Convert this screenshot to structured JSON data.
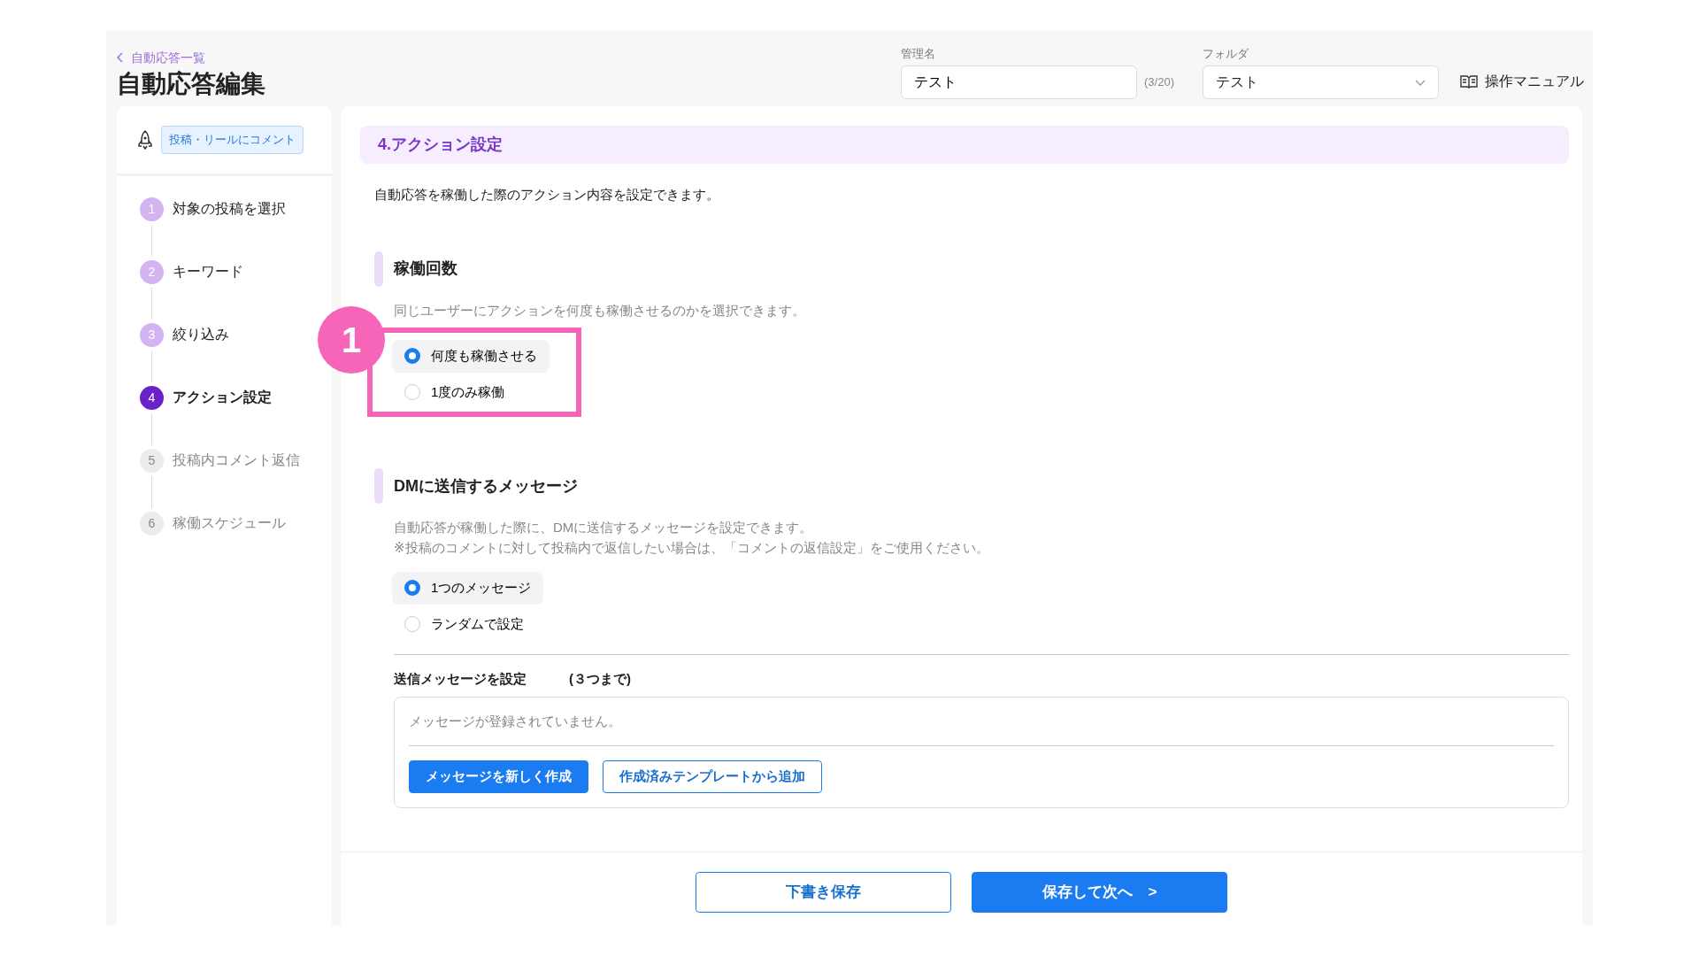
{
  "header": {
    "back_link": "自動応答一覧",
    "title": "自動応答編集",
    "name_field": {
      "label": "管理名",
      "value": "テスト",
      "counter": "(3/20)"
    },
    "folder_field": {
      "label": "フォルダ",
      "value": "テスト"
    },
    "manual_link": "操作マニュアル"
  },
  "sidebar": {
    "trigger_badge": "投稿・リールにコメント",
    "steps": [
      {
        "number": "1",
        "label": "対象の投稿を選択",
        "completed": true,
        "selected": false
      },
      {
        "number": "2",
        "label": "キーワード",
        "completed": true,
        "selected": false
      },
      {
        "number": "3",
        "label": "絞り込み",
        "completed": true,
        "selected": false
      },
      {
        "number": "4",
        "label": "アクション設定",
        "completed": false,
        "selected": true
      },
      {
        "number": "5",
        "label": "投稿内コメント返信",
        "completed": false,
        "selected": false
      },
      {
        "number": "6",
        "label": "稼働スケジュール",
        "completed": false,
        "selected": false
      }
    ]
  },
  "main": {
    "section_title": "4.アクション設定",
    "intro": "自動応答を稼働した際のアクション内容を設定できます。",
    "run_count": {
      "heading": "稼働回数",
      "description": "同じユーザーにアクションを何度も稼働させるのかを選択できます。",
      "annotation": "1",
      "options": [
        {
          "label": "何度も稼働させる",
          "selected": true
        },
        {
          "label": "1度のみ稼働",
          "selected": false
        }
      ]
    },
    "dm_message": {
      "heading": "DMに送信するメッセージ",
      "description_lines": [
        "自動応答が稼働した際に、DMに送信するメッセージを設定できます。",
        "※投稿のコメントに対して投稿内で返信したい場合は、「コメントの返信設定」をご使用ください。"
      ],
      "options": [
        {
          "label": "1つのメッセージ",
          "selected": true
        },
        {
          "label": "ランダムで設定",
          "selected": false
        }
      ],
      "messages_label": "送信メッセージを設定",
      "messages_limit": "(３つまで)",
      "empty_text": "メッセージが登録されていません。",
      "create_button": "メッセージを新しく作成",
      "template_button": "作成済みテンプレートから追加"
    }
  },
  "footer": {
    "draft_button": "下書き保存",
    "next_button": "保存して次へ",
    "next_icon": ">"
  }
}
